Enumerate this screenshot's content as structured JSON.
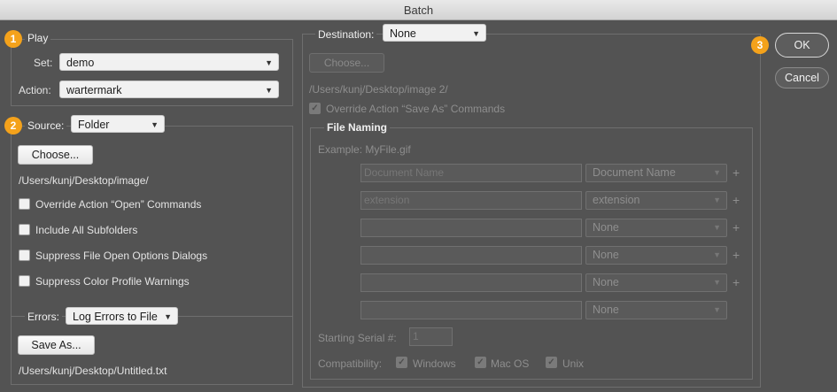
{
  "window": {
    "title": "Batch"
  },
  "badges": {
    "play": "1",
    "source": "2",
    "ok": "3"
  },
  "play": {
    "legend": "Play",
    "set_label": "Set:",
    "set_value": "demo",
    "action_label": "Action:",
    "action_value": "wartermark"
  },
  "source": {
    "label": "Source:",
    "value": "Folder",
    "choose_label": "Choose...",
    "path": "/Users/kunj/Desktop/image/",
    "checkboxes": [
      "Override Action “Open” Commands",
      "Include All Subfolders",
      "Suppress File Open Options Dialogs",
      "Suppress Color Profile Warnings"
    ]
  },
  "errors": {
    "label": "Errors:",
    "value": "Log Errors to File",
    "saveas_label": "Save As...",
    "path": "/Users/kunj/Desktop/Untitled.txt"
  },
  "destination": {
    "label": "Destination:",
    "value": "None",
    "choose_label": "Choose...",
    "path": "/Users/kunj/Desktop/image 2/",
    "override_label": "Override Action “Save As” Commands"
  },
  "file_naming": {
    "legend": "File Naming",
    "example": "Example: MyFile.gif",
    "rows": [
      {
        "field": "Document Name",
        "select": "Document Name",
        "plus": "+"
      },
      {
        "field": "extension",
        "select": "extension",
        "plus": "+"
      },
      {
        "field": "",
        "select": "None",
        "plus": "+"
      },
      {
        "field": "",
        "select": "None",
        "plus": "+"
      },
      {
        "field": "",
        "select": "None",
        "plus": "+"
      },
      {
        "field": "",
        "select": "None",
        "plus": ""
      }
    ],
    "serial_label": "Starting Serial #:",
    "serial_value": "1",
    "compat_label": "Compatibility:",
    "compat_options": [
      "Windows",
      "Mac OS",
      "Unix"
    ]
  },
  "actions": {
    "ok_label": "OK",
    "cancel_label": "Cancel"
  },
  "colors": {
    "accent_badge": "#f4a21b",
    "dialog_bg": "#535353"
  }
}
